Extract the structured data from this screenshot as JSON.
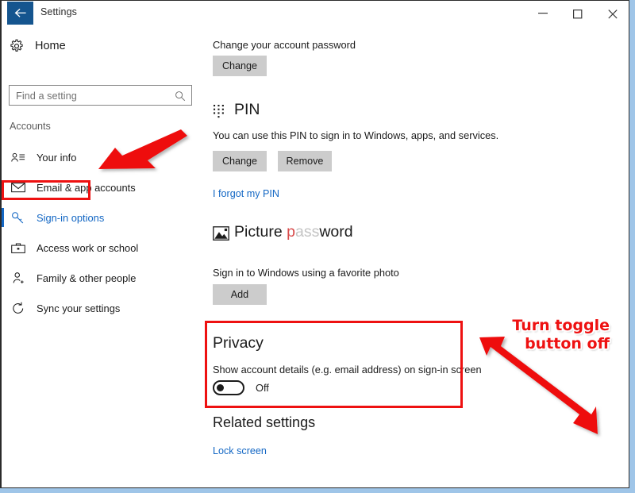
{
  "window": {
    "title": "Settings",
    "back_icon": "back-arrow-icon",
    "controls": {
      "minimize": "minimize-icon",
      "maximize": "maximize-icon",
      "close": "close-icon"
    }
  },
  "sidebar": {
    "home_label": "Home",
    "home_icon": "gear-icon",
    "search": {
      "placeholder": "Find a setting",
      "value": "",
      "icon": "search-icon"
    },
    "group_title": "Accounts",
    "items": [
      {
        "label": "Your info",
        "icon": "user-card-icon",
        "selected": false
      },
      {
        "label": "Email & app accounts",
        "icon": "envelope-icon",
        "selected": false
      },
      {
        "label": "Sign-in options",
        "icon": "key-icon",
        "selected": true
      },
      {
        "label": "Access work or school",
        "icon": "briefcase-icon",
        "selected": false
      },
      {
        "label": "Family & other people",
        "icon": "person-add-icon",
        "selected": false
      },
      {
        "label": "Sync your settings",
        "icon": "sync-icon",
        "selected": false
      }
    ]
  },
  "content": {
    "password": {
      "description": "Change your account password",
      "change_button": "Change"
    },
    "pin": {
      "heading": "PIN",
      "icon": "pin-keypad-icon",
      "description": "You can use this PIN to sign in to Windows, apps, and services.",
      "change_button": "Change",
      "remove_button": "Remove",
      "forgot_link": "I forgot my PIN"
    },
    "picture_password": {
      "icon": "picture-icon",
      "heading_parts": [
        {
          "text": "Picture ",
          "shade": "dark"
        },
        {
          "text": "p",
          "shade": "red"
        },
        {
          "text": "ass",
          "shade": "faint"
        },
        {
          "text": "word",
          "shade": "dark"
        }
      ],
      "heading_plain": "Picture password",
      "description": "Sign in to Windows using a favorite photo",
      "add_button": "Add"
    },
    "privacy": {
      "heading": "Privacy",
      "description": "Show account details (e.g. email address) on sign-in screen",
      "toggle_state": "Off"
    },
    "related": {
      "heading": "Related settings",
      "link": "Lock screen"
    }
  },
  "annotations": {
    "accent_color": "#ee1111",
    "callout_line1": "Turn toggle",
    "callout_line2": "button off",
    "boxes": [
      "sign-in-options-highlight",
      "privacy-section-highlight"
    ],
    "arrows": [
      "arrow-to-sign-in-options",
      "arrow-to-privacy-toggle"
    ]
  }
}
